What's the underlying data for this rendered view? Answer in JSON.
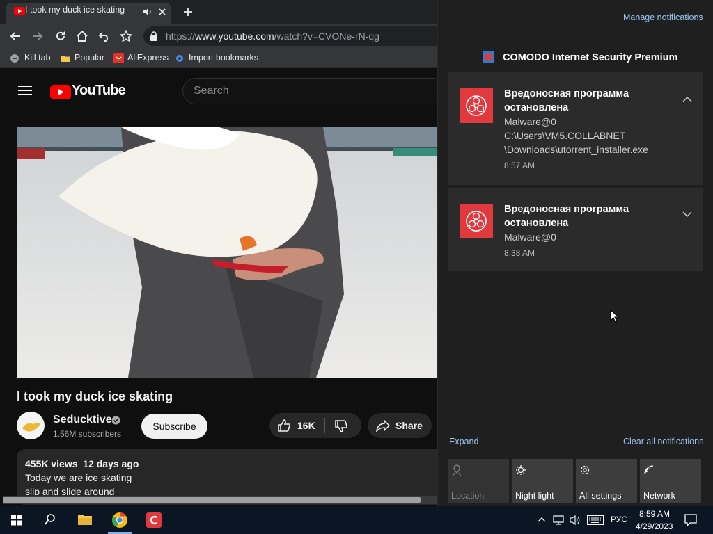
{
  "browser": {
    "tab_title": "I took my duck ice skating -",
    "new_tab_icon": "plus-icon",
    "url_base": "https://",
    "url_domain": "www.youtube.com",
    "url_path": "/watch?v=CVONe-rN-qg",
    "bookmarks": [
      {
        "label": "Kill tab",
        "icon": "kill-tab-icon"
      },
      {
        "label": "Popular",
        "icon": "folder-icon"
      },
      {
        "label": "AliExpress",
        "icon": "aliexpress-icon"
      },
      {
        "label": "Import bookmarks",
        "icon": "gear-icon"
      }
    ]
  },
  "youtube": {
    "logo_text": "YouTube",
    "search_placeholder": "Search",
    "video_title": "I took my duck ice skating",
    "channel_name": "Seducktive",
    "subscribers": "1.56M subscribers",
    "subscribe_label": "Subscribe",
    "likes": "16K",
    "share_label": "Share",
    "views": "455K views",
    "uploaded": "12 days ago",
    "description_lines": [
      "Today we are ice skating",
      "slip and slide around"
    ]
  },
  "action_center": {
    "manage_label": "Manage notifications",
    "app_name": "COMODO Internet Security Premium",
    "notifications": [
      {
        "title_lines": [
          "Вредоносная программа",
          "остановлена"
        ],
        "body_lines": [
          "Malware@0",
          "C:\\Users\\VM5.COLLABNET",
          "\\Downloads\\utorrent_installer.exe"
        ],
        "time": "8:57 AM",
        "expanded": true
      },
      {
        "title_lines": [
          "Вредоносная программа",
          "остановлена"
        ],
        "body_lines": [
          "Malware@0"
        ],
        "time": "8:38 AM",
        "expanded": false
      }
    ],
    "expand_label": "Expand",
    "clear_label": "Clear all notifications",
    "quick_actions": [
      {
        "label": "Location",
        "icon": "location-icon",
        "enabled": false
      },
      {
        "label": "Night light",
        "icon": "brightness-icon",
        "enabled": true
      },
      {
        "label": "All settings",
        "icon": "gear-icon",
        "enabled": true
      },
      {
        "label": "Network",
        "icon": "network-icon",
        "enabled": true
      }
    ]
  },
  "taskbar": {
    "language": "РУС",
    "time": "8:59 AM",
    "date": "4/29/2023"
  },
  "colors": {
    "accent_link": "#99c4f0",
    "comodo_red": "#e03a3e",
    "youtube_red": "#ff0000"
  }
}
